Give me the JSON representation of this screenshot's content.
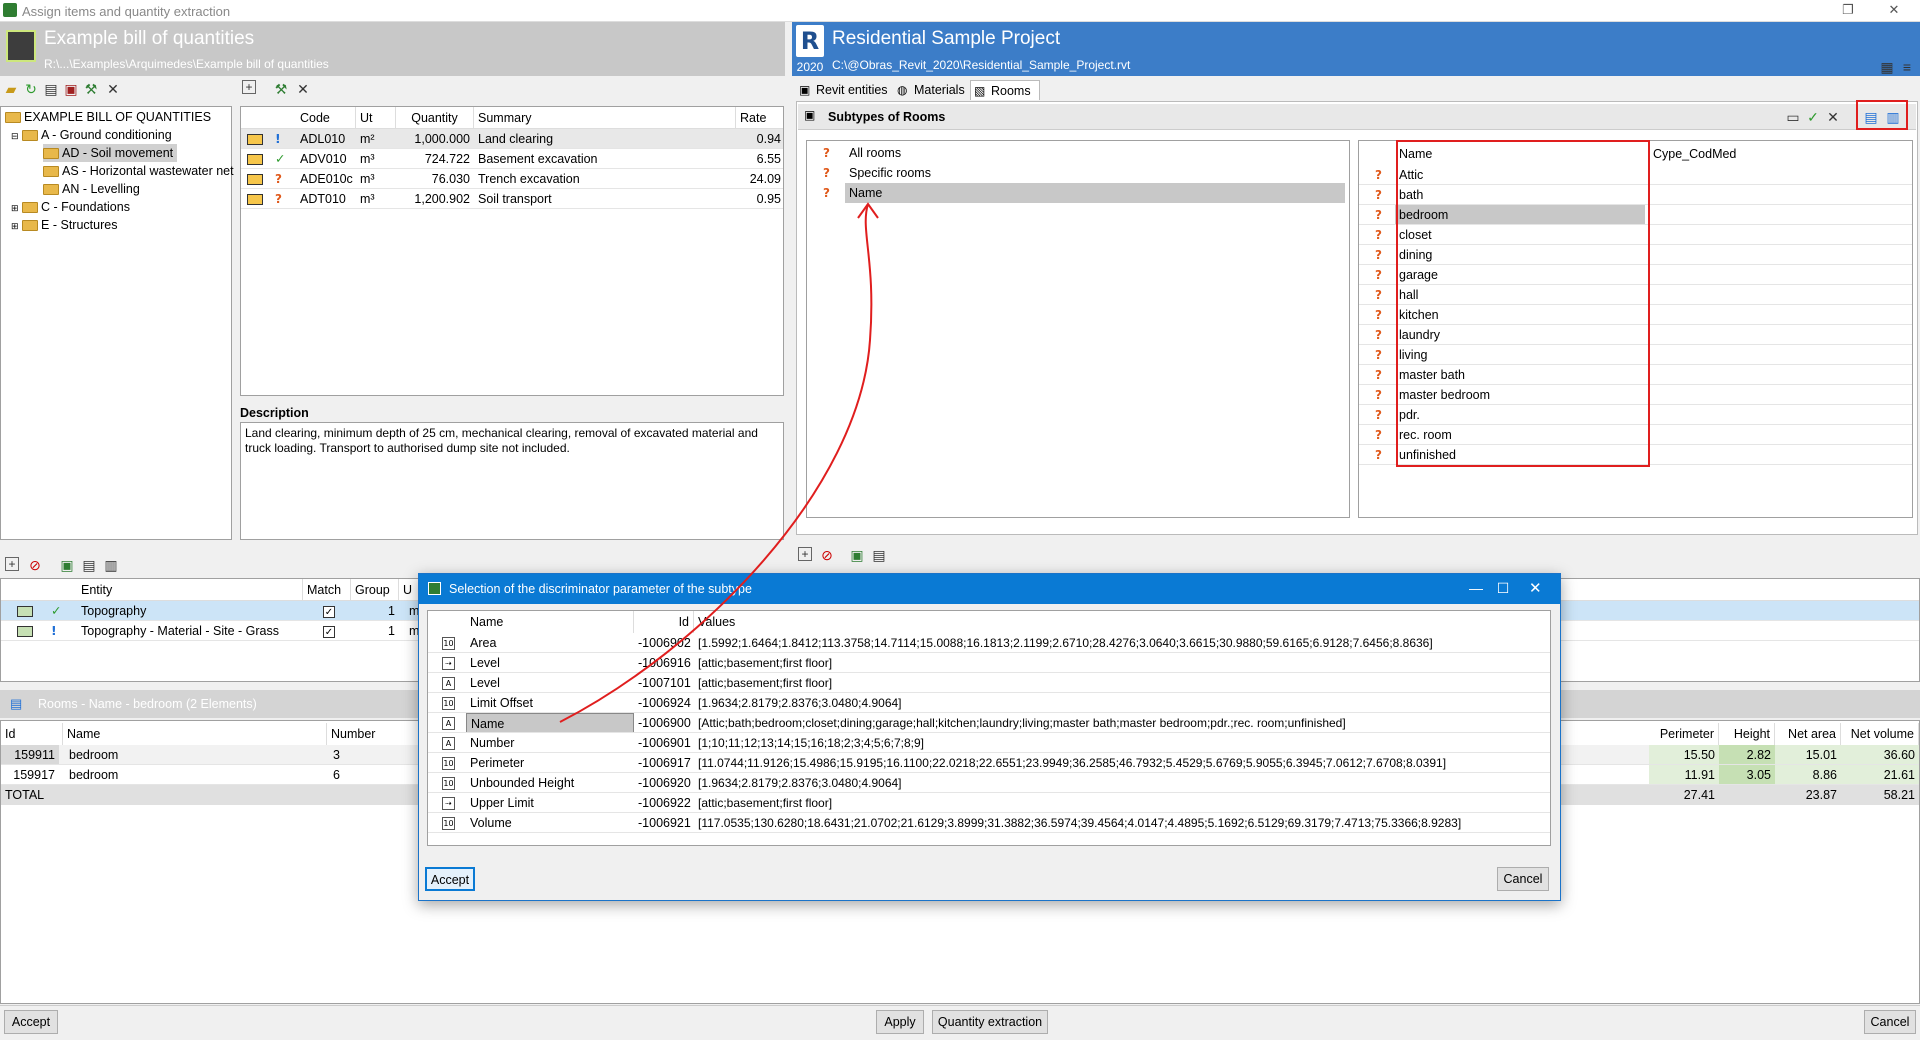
{
  "window": {
    "title": "Assign items and quantity extraction",
    "restore": "❐",
    "close": "✕"
  },
  "left_header": {
    "title": "Example bill of quantities",
    "path": "R:\\...\\Examples\\Arquimedes\\Example bill of quantities"
  },
  "right_header": {
    "title": "Residential Sample Project",
    "path": "C:\\@Obras_Revit_2020\\Residential_Sample_Project.rvt",
    "year": "2020",
    "logo": "R"
  },
  "tree": {
    "root": "EXAMPLE BILL OF QUANTITIES",
    "items": [
      {
        "label": "A - Ground conditioning",
        "level": 1
      },
      {
        "label": "AD - Soil movement",
        "level": 2,
        "selected": true
      },
      {
        "label": "AS - Horizontal wastewater net",
        "level": 2
      },
      {
        "label": "AN - Levelling",
        "level": 2
      },
      {
        "label": "C - Foundations",
        "level": 1
      },
      {
        "label": "E - Structures",
        "level": 1
      }
    ]
  },
  "items_table": {
    "headers": {
      "code": "Code",
      "ut": "Ut",
      "quantity": "Quantity",
      "summary": "Summary",
      "rate": "Rate"
    },
    "rows": [
      {
        "status": "!",
        "code": "ADL010",
        "ut": "m²",
        "quantity": "1,000.000",
        "summary": "Land clearing",
        "rate": "0.94"
      },
      {
        "status": "✓",
        "code": "ADV010",
        "ut": "m³",
        "quantity": "724.722",
        "summary": "Basement excavation",
        "rate": "6.55"
      },
      {
        "status": "?",
        "code": "ADE010c",
        "ut": "m³",
        "quantity": "76.030",
        "summary": "Trench excavation",
        "rate": "24.09"
      },
      {
        "status": "?",
        "code": "ADT010",
        "ut": "m³",
        "quantity": "1,200.902",
        "summary": "Soil transport",
        "rate": "0.95"
      }
    ]
  },
  "description": {
    "heading": "Description",
    "text": "Land clearing, minimum depth of 25 cm, mechanical clearing, removal of excavated material and truck loading. Transport to authorised dump site not included."
  },
  "tabs": [
    {
      "label": "Revit entities"
    },
    {
      "label": "Materials"
    },
    {
      "label": "Rooms"
    }
  ],
  "subtypes": {
    "heading": "Subtypes of Rooms",
    "list": [
      "All rooms",
      "Specific rooms",
      "Name"
    ],
    "names_header": "Name",
    "cype_header": "Cype_CodMed",
    "names": [
      "Attic",
      "bath",
      "bedroom",
      "closet",
      "dining",
      "garage",
      "hall",
      "kitchen",
      "laundry",
      "living",
      "master bath",
      "master bedroom",
      "pdr.",
      "rec. room",
      "unfinished"
    ]
  },
  "entity_table": {
    "headers": {
      "entity": "Entity",
      "match": "Match",
      "group": "Group",
      "ut": "U"
    },
    "rows": [
      {
        "status": "✓",
        "entity": "Topography",
        "match": "✓",
        "group": "1",
        "ut": "m"
      },
      {
        "status": "!",
        "entity": "Topography - Material - Site - Grass",
        "match": "✓",
        "group": "1",
        "ut": "m"
      }
    ]
  },
  "rooms": {
    "title": "Rooms - Name - bedroom (2 Elements)",
    "headers": {
      "id": "Id",
      "name": "Name",
      "number": "Number",
      "perimeter": "Perimeter",
      "height": "Height",
      "net_area": "Net area",
      "net_volume": "Net volume"
    },
    "rows": [
      {
        "id": "159911",
        "name": "bedroom",
        "number": "3",
        "perimeter": "15.50",
        "height": "2.82",
        "net_area": "15.01",
        "net_volume": "36.60"
      },
      {
        "id": "159917",
        "name": "bedroom",
        "number": "6",
        "perimeter": "11.91",
        "height": "3.05",
        "net_area": "8.86",
        "net_volume": "21.61"
      }
    ],
    "total": {
      "label": "TOTAL",
      "perimeter": "27.41",
      "net_area": "23.87",
      "net_volume": "58.21"
    }
  },
  "dialog": {
    "title": "Selection of the discriminator parameter of the subtype",
    "headers": {
      "name": "Name",
      "id": "Id",
      "values": "Values"
    },
    "rows": [
      {
        "icon": "10",
        "name": "Area",
        "id": "-1006902",
        "values": "[1.5992;1.6464;1.8412;113.3758;14.7114;15.0088;16.1813;2.1199;2.6710;28.4276;3.0640;3.6615;30.9880;59.6165;6.9128;7.6456;8.8636]"
      },
      {
        "icon": "lv",
        "name": "Level",
        "id": "-1006916",
        "values": "[attic;basement;first floor]"
      },
      {
        "icon": "A",
        "name": "Level",
        "id": "-1007101",
        "values": "[attic;basement;first floor]"
      },
      {
        "icon": "10",
        "name": "Limit Offset",
        "id": "-1006924",
        "values": "[1.9634;2.8179;2.8376;3.0480;4.9064]"
      },
      {
        "icon": "A",
        "name": "Name",
        "id": "-1006900",
        "values": "[Attic;bath;bedroom;closet;dining;garage;hall;kitchen;laundry;living;master bath;master bedroom;pdr.;rec. room;unfinished]",
        "selected": true
      },
      {
        "icon": "A",
        "name": "Number",
        "id": "-1006901",
        "values": "[1;10;11;12;13;14;15;16;18;2;3;4;5;6;7;8;9]"
      },
      {
        "icon": "10",
        "name": "Perimeter",
        "id": "-1006917",
        "values": "[11.0744;11.9126;15.4986;15.9195;16.1100;22.0218;22.6551;23.9949;36.2585;46.7932;5.4529;5.6769;5.9055;6.3945;7.0612;7.6708;8.0391]"
      },
      {
        "icon": "10",
        "name": "Unbounded Height",
        "id": "-1006920",
        "values": "[1.9634;2.8179;2.8376;3.0480;4.9064]"
      },
      {
        "icon": "lv",
        "name": "Upper Limit",
        "id": "-1006922",
        "values": "[attic;basement;first floor]"
      },
      {
        "icon": "10",
        "name": "Volume",
        "id": "-1006921",
        "values": "[117.0535;130.6280;18.6431;21.0702;21.6129;3.8999;31.3882;36.5974;39.4564;4.0147;4.4895;5.1692;6.5129;69.3179;7.4713;75.3366;8.9283]"
      }
    ],
    "accept": "Accept",
    "cancel": "Cancel"
  },
  "footer": {
    "accept": "Accept",
    "apply": "Apply",
    "quantity_extraction": "Quantity extraction",
    "cancel": "Cancel"
  }
}
